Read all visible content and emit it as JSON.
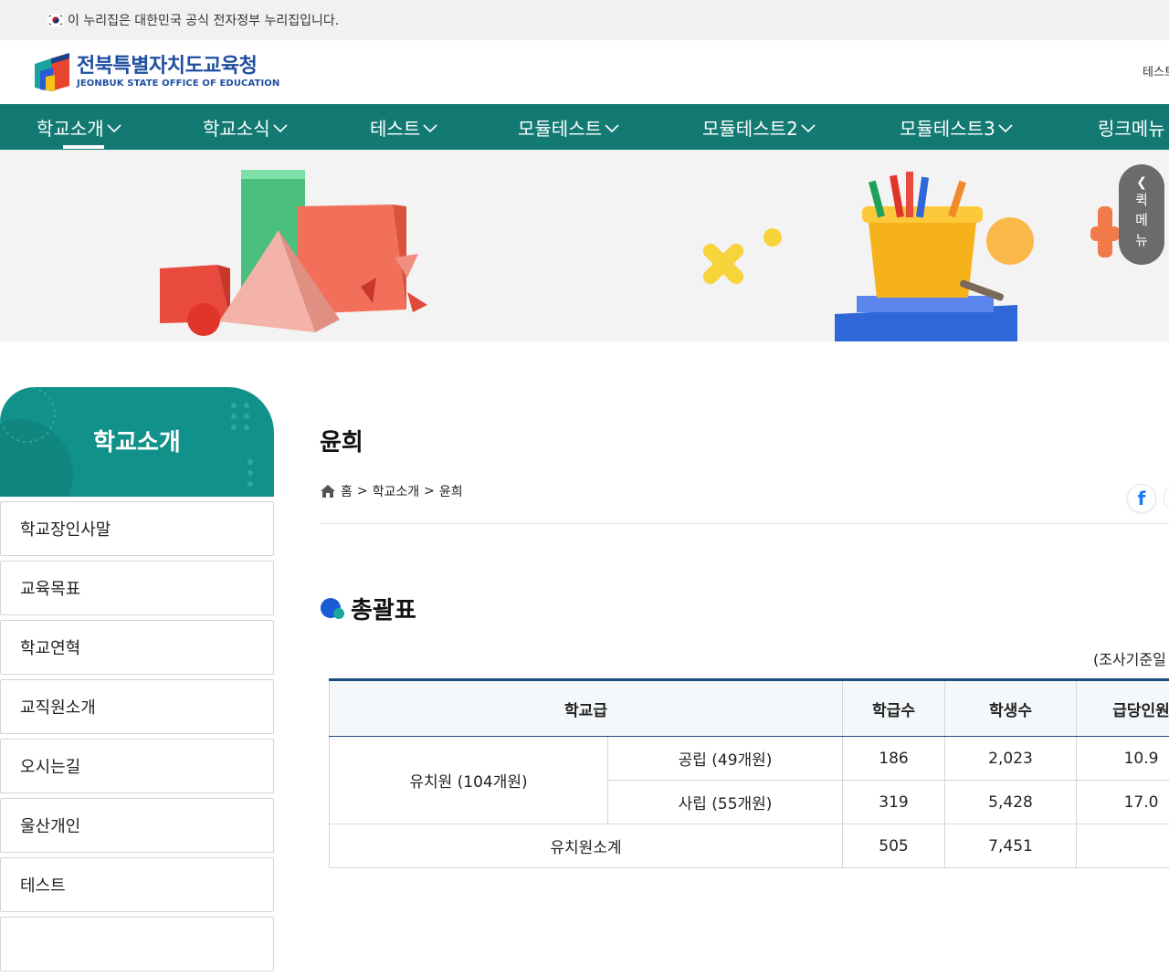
{
  "gov_bar": {
    "text": "이 누리집은 대한민국 공식 전자정부 누리집입니다."
  },
  "header": {
    "logo_ko": "전북특별자치도교육청",
    "logo_en": "JEONBUK STATE OFFICE OF EDUCATION",
    "util_text": "테스트"
  },
  "gnb": {
    "items": [
      {
        "label": "학교소개"
      },
      {
        "label": "학교소식"
      },
      {
        "label": "테스트"
      },
      {
        "label": "모듈테스트"
      },
      {
        "label": "모듈테스트2"
      },
      {
        "label": "모듈테스트3"
      },
      {
        "label": "링크메뉴"
      }
    ]
  },
  "quick_menu": {
    "label": "퀵메뉴"
  },
  "sidebar": {
    "title": "학교소개",
    "items": [
      {
        "label": "학교장인사말"
      },
      {
        "label": "교육목표"
      },
      {
        "label": "학교연혁"
      },
      {
        "label": "교직원소개"
      },
      {
        "label": "오시는길"
      },
      {
        "label": "울산개인"
      },
      {
        "label": "테스트"
      }
    ]
  },
  "content": {
    "title": "윤희",
    "breadcrumb": {
      "home": "홈",
      "sep": ">",
      "section": "학교소개",
      "current": "윤희"
    },
    "share": {
      "facebook": "f"
    },
    "section_title": "총괄표",
    "survey_note": "(조사기준일"
  },
  "table": {
    "headers": {
      "level": "학교급",
      "classes": "학급수",
      "students": "학생수",
      "per_class": "급당인원"
    },
    "group_label": "유치원 (104개원)",
    "rows": [
      {
        "type": "공립 (49개원)",
        "classes": "186",
        "students": "2,023",
        "per_class": "10.9"
      },
      {
        "type": "사립 (55개원)",
        "classes": "319",
        "students": "5,428",
        "per_class": "17.0"
      }
    ],
    "subtotal": {
      "label": "유치원소계",
      "classes": "505",
      "students": "7,451",
      "per_class": ""
    }
  }
}
